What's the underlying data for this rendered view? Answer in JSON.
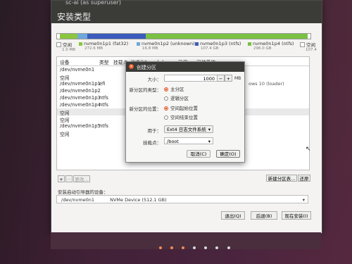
{
  "window": {
    "subtitle": "sc-ai (as superuser)",
    "title": "安装类型"
  },
  "partition_bar": {
    "segments": [
      {
        "name": "空闲",
        "color": "#ffffff"
      },
      {
        "name": "nvme0n1p1 (fat32)",
        "color": "#8cc63f"
      },
      {
        "name": "nvme0n1p2 (unknown)",
        "color": "#6fa8dc"
      },
      {
        "name": "nvme0n1p3 (ntfs)",
        "color": "#3b5bbd"
      },
      {
        "name": "nvme0n1p4 (ntfs)",
        "color": "#7ac143"
      },
      {
        "name": "空闲",
        "color": "#ffffff"
      }
    ],
    "legend": [
      {
        "label": "空闲",
        "size": "1.0 MB",
        "color": "#ffffff"
      },
      {
        "label": "nvme0n1p1 (fat32)",
        "size": "272.6 MB",
        "color": "#8cc63f"
      },
      {
        "label": "nvme0n1p2 (unknown)",
        "size": "16.8 MB",
        "color": "#6fa8dc"
      },
      {
        "label": "nvme0n1p3 (ntfs)",
        "size": "107.4 GB",
        "color": "#3b5bbd"
      },
      {
        "label": "nvme0n1p4 (ntfs)",
        "size": "296.0 GB",
        "color": "#7ac143"
      },
      {
        "label": "空闲",
        "size": "107.4",
        "color": "#ffffff"
      }
    ]
  },
  "table": {
    "headers": [
      "设备",
      "类型",
      "挂载点",
      "格式化?",
      "大小",
      "已用",
      "已装系统"
    ],
    "rows": [
      {
        "device": "/dev/nvme0n1",
        "type": ""
      },
      {
        "device": "空闲",
        "type": ""
      },
      {
        "device": "/dev/nvme0n1p1",
        "type": "efi"
      },
      {
        "device": "/dev/nvme0n1p2",
        "type": ""
      },
      {
        "device": "/dev/nvme0n1p3",
        "type": "ntfs"
      },
      {
        "device": "/dev/nvme0n1p4",
        "type": "ntfs"
      },
      {
        "device": "空闲",
        "type": ""
      },
      {
        "device": "空闲",
        "type": ""
      },
      {
        "device": "/dev/nvme0n1p5",
        "type": "ntfs"
      },
      {
        "device": "空闲",
        "type": ""
      }
    ],
    "right_partial": "ows 10 (loader)"
  },
  "table_toolbar": {
    "add": "+",
    "remove": "−",
    "change": "更改...",
    "new_table": "新建分区表...",
    "revert": "还原"
  },
  "boot_device": {
    "label": "安装启动引导器的设备：",
    "device": "/dev/nvme0n1",
    "description": "NVMe Device (512.1 GB)"
  },
  "bottom_buttons": {
    "quit": "退出(Q)",
    "back": "后退(B)",
    "install": "现在安装(I)"
  },
  "dialog": {
    "title": "创建分区",
    "size_label": "大小：",
    "size_value": "1000",
    "size_unit": "MB",
    "type_label": "新分区的类型：",
    "type_primary": "主分区",
    "type_logical": "逻辑分区",
    "location_label": "新分区的位置：",
    "location_start": "空间起始位置",
    "location_end": "空间结束位置",
    "use_label": "用于：",
    "use_value": "Ext4 日志文件系统",
    "mount_label": "挂载点：",
    "mount_value": "/boot",
    "cancel": "取消(C)",
    "ok": "确定(O)"
  },
  "progress_dots": {
    "total": 7,
    "done": 3
  }
}
